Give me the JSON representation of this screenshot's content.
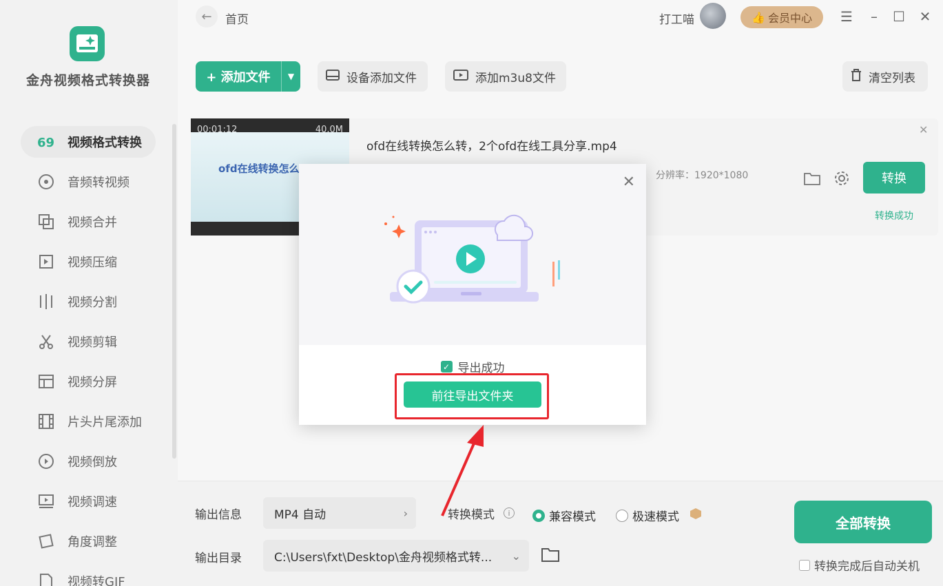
{
  "app": {
    "name": "金舟视频格式转换器"
  },
  "sidebar": {
    "items": [
      {
        "label": "视频格式转换",
        "icon": "format-convert-icon",
        "active": true
      },
      {
        "label": "音频转视频",
        "icon": "audio-icon"
      },
      {
        "label": "视频合并",
        "icon": "merge-icon"
      },
      {
        "label": "视频压缩",
        "icon": "compress-icon"
      },
      {
        "label": "视频分割",
        "icon": "split-icon"
      },
      {
        "label": "视频剪辑",
        "icon": "scissors-icon"
      },
      {
        "label": "视频分屏",
        "icon": "split-screen-icon"
      },
      {
        "label": "片头片尾添加",
        "icon": "film-icon"
      },
      {
        "label": "视频倒放",
        "icon": "reverse-icon"
      },
      {
        "label": "视频调速",
        "icon": "speed-icon"
      },
      {
        "label": "角度调整",
        "icon": "rotate-icon"
      },
      {
        "label": "视频转GIF",
        "icon": "gif-icon"
      }
    ]
  },
  "header": {
    "breadcrumb": "首页",
    "username": "打工喵",
    "vip_label": "会员中心"
  },
  "toolbar": {
    "add_file": "添加文件",
    "device_add": "设备添加文件",
    "add_m3u8": "添加m3u8文件",
    "clear_list": "清空列表"
  },
  "file": {
    "duration": "00:01:12",
    "size": "40.0M",
    "thumb_title": "ofd在线转换怎么",
    "name": "ofd在线转换怎么转，2个ofd在线工具分享.mp4",
    "resolution": "分辨率：1920*1080",
    "convert_label": "转换",
    "status": "转换成功"
  },
  "bottom": {
    "output_info_label": "输出信息",
    "output_format": "MP4 自动",
    "mode_label": "转换模式",
    "mode_compat": "兼容模式",
    "mode_fast": "极速模式",
    "output_dir_label": "输出目录",
    "output_dir": "C:\\Users\\fxt\\Desktop\\金舟视频格式转...",
    "convert_all": "全部转换",
    "auto_shutdown": "转换完成后自动关机"
  },
  "dialog": {
    "status": "导出成功",
    "open_folder": "前往导出文件夹"
  },
  "colors": {
    "accent": "#2fb28d",
    "highlight": "#e8262d"
  }
}
